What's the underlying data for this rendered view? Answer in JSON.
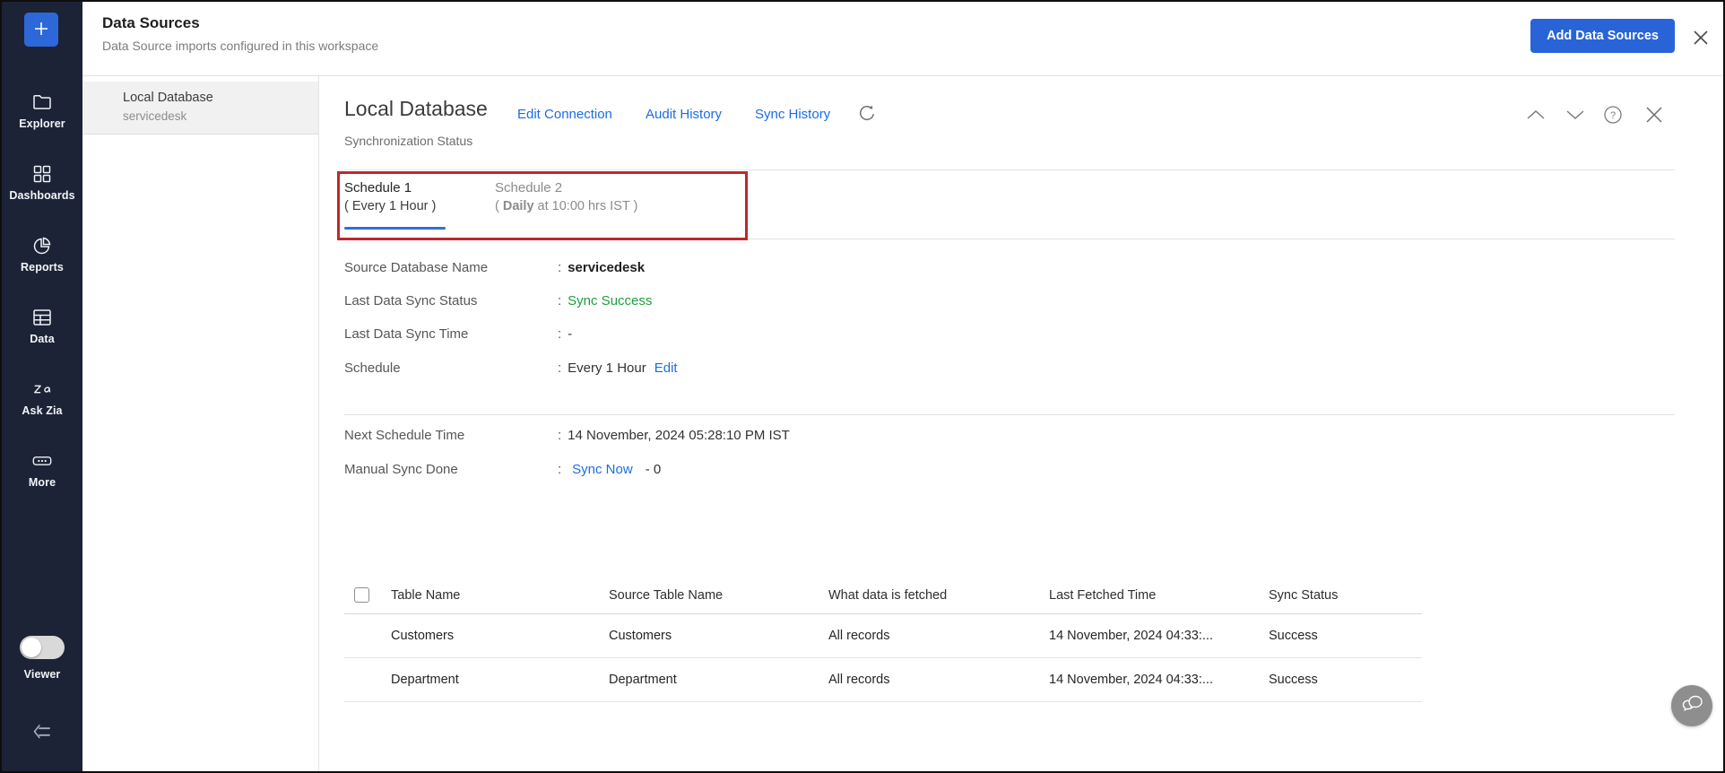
{
  "colors": {
    "accent_blue": "#1b6ce8",
    "button_blue": "#2864d8",
    "sidebar_bg": "#1c2336",
    "success_green": "#1f9c3d",
    "annotation_red": "#c0272d"
  },
  "sidebar": {
    "items": [
      {
        "label": "Explorer",
        "icon": "folder-icon"
      },
      {
        "label": "Dashboards",
        "icon": "dashboard-grid-icon"
      },
      {
        "label": "Reports",
        "icon": "pie-chart-icon"
      },
      {
        "label": "Data",
        "icon": "data-table-icon"
      },
      {
        "label": "Ask Zia",
        "icon": "zia-icon"
      },
      {
        "label": "More",
        "icon": "more-ellipsis-icon"
      }
    ],
    "viewer": {
      "label": "Viewer",
      "toggle_state": "off"
    }
  },
  "header": {
    "title": "Data Sources",
    "subtitle": "Data Source imports configured in this workspace",
    "add_button_label": "Add Data Sources"
  },
  "source_list": {
    "items": [
      {
        "name": "Local Database",
        "database": "servicedesk",
        "selected": true
      }
    ]
  },
  "detail": {
    "title": "Local Database",
    "links": [
      {
        "label": "Edit Connection"
      },
      {
        "label": "Audit History"
      },
      {
        "label": "Sync History"
      }
    ],
    "section_label": "Synchronization Status",
    "tabs": [
      {
        "title": "Schedule 1",
        "subtitle": "( Every 1 Hour )",
        "active": true
      },
      {
        "title": "Schedule 2",
        "subtitle_open": "( ",
        "subtitle_bold": "Daily",
        "subtitle_rest": " at 10:00 hrs IST )",
        "active": false
      }
    ],
    "fields": [
      {
        "label": "Source Database Name",
        "separator": ":",
        "value": "servicedesk"
      },
      {
        "label": "Last Data Sync Status",
        "separator": ":",
        "value": "Sync Success"
      },
      {
        "label": "Last Data Sync Time",
        "separator": ":",
        "value": "-"
      },
      {
        "label": "Schedule",
        "separator": ":",
        "value": "Every 1 Hour",
        "action": "Edit"
      }
    ],
    "schedule_info": [
      {
        "label": "Next Schedule Time",
        "separator": ":",
        "value": "14 November, 2024 05:28:10 PM IST"
      },
      {
        "label": "Manual Sync Done",
        "separator": ":",
        "link": "Sync Now",
        "suffix": "- 0"
      }
    ],
    "table": {
      "columns": [
        "Table Name",
        "Source Table Name",
        "What data is fetched",
        "Last Fetched Time",
        "Sync Status"
      ],
      "rows": [
        {
          "table_name": "Customers",
          "source_table_name": "Customers",
          "what_fetched": "All records",
          "last_fetched": "14 November, 2024 04:33:...",
          "sync_status": "Success"
        },
        {
          "table_name": "Department",
          "source_table_name": "Department",
          "what_fetched": "All records",
          "last_fetched": "14 November, 2024 04:33:...",
          "sync_status": "Success"
        }
      ]
    }
  }
}
